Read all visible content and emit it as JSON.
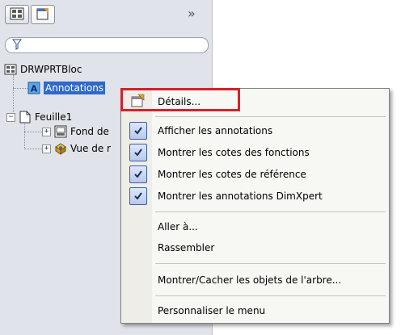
{
  "panel": {
    "toolbar": {
      "tab1_icon": "feature-tree-icon",
      "tab2_icon": "property-manager-icon",
      "overflow_label": "»"
    },
    "filter": {
      "icon": "filter-icon",
      "value": ""
    },
    "tree": [
      {
        "label": "DRWPRTBloc",
        "icon": "drawing-icon"
      },
      {
        "label": "Annotations",
        "icon": "annotations-icon",
        "selected": true
      },
      {
        "label": "Feuille1",
        "icon": "sheet-icon",
        "expander": "⊟"
      },
      {
        "label": "Fond de",
        "icon": "sheet-format-icon",
        "expander": "+"
      },
      {
        "label": "Vue de r",
        "icon": "drawing-view-icon",
        "expander": "+"
      }
    ]
  },
  "menu": {
    "items": [
      {
        "label": "Détails...",
        "icon": "details-icon",
        "checked": false
      },
      {
        "label": "Afficher les annotations",
        "checked": true
      },
      {
        "label": "Montrer les cotes des fonctions",
        "checked": true
      },
      {
        "label": "Montrer les cotes de référence",
        "checked": true
      },
      {
        "label": "Montrer les annotations DimXpert",
        "checked": true
      },
      {
        "label": "Aller à...",
        "checked": false
      },
      {
        "label": "Rassembler",
        "checked": false
      },
      {
        "label": "Montrer/Cacher les objets de l'arbre...",
        "checked": false
      },
      {
        "label": "Personnaliser le menu",
        "checked": false
      }
    ],
    "highlight_color": "#d6202a"
  }
}
